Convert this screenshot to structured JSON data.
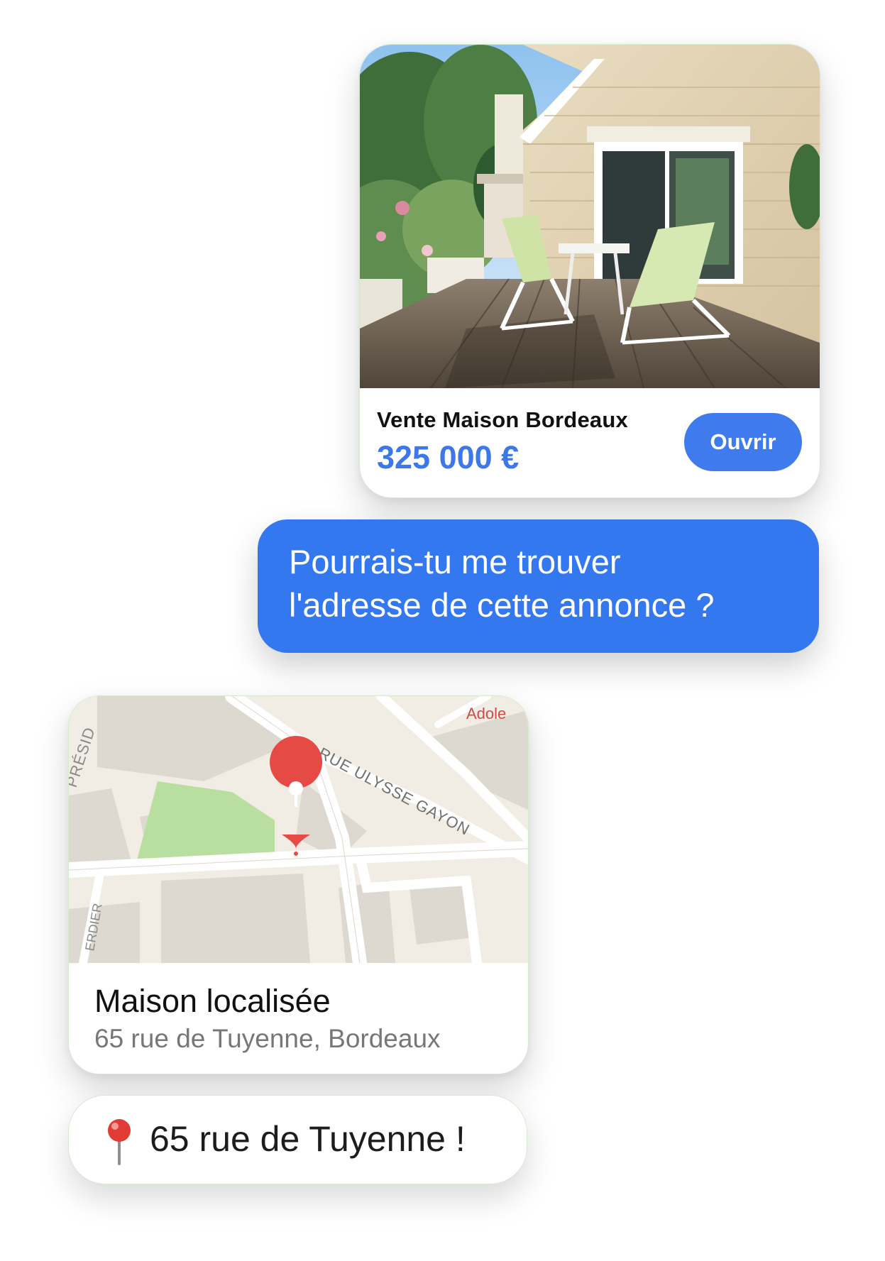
{
  "listing": {
    "title": "Vente Maison Bordeaux",
    "price": "325 000 €",
    "open_button": "Ouvrir",
    "photo_icon": "house-terrace-photo"
  },
  "user_message": {
    "line1": "Pourrais-tu me trouver",
    "line2": "l'adresse de cette annonce ?"
  },
  "map": {
    "street_labels": [
      "RUE ULYSSE GAYON",
      "PRÉSID",
      "ERDIER",
      "Adole"
    ],
    "title": "Maison localisée",
    "address": "65 rue de Tuyenne, Bordeaux",
    "marker_icon": "map-pin-icon"
  },
  "reply": {
    "icon": "round-pushpin-icon",
    "text": "65 rue de Tuyenne !"
  },
  "colors": {
    "accent": "#3f7bec",
    "user_bubble": "#3478f0",
    "price": "#3e78e8",
    "map_marker": "#e64a45"
  }
}
